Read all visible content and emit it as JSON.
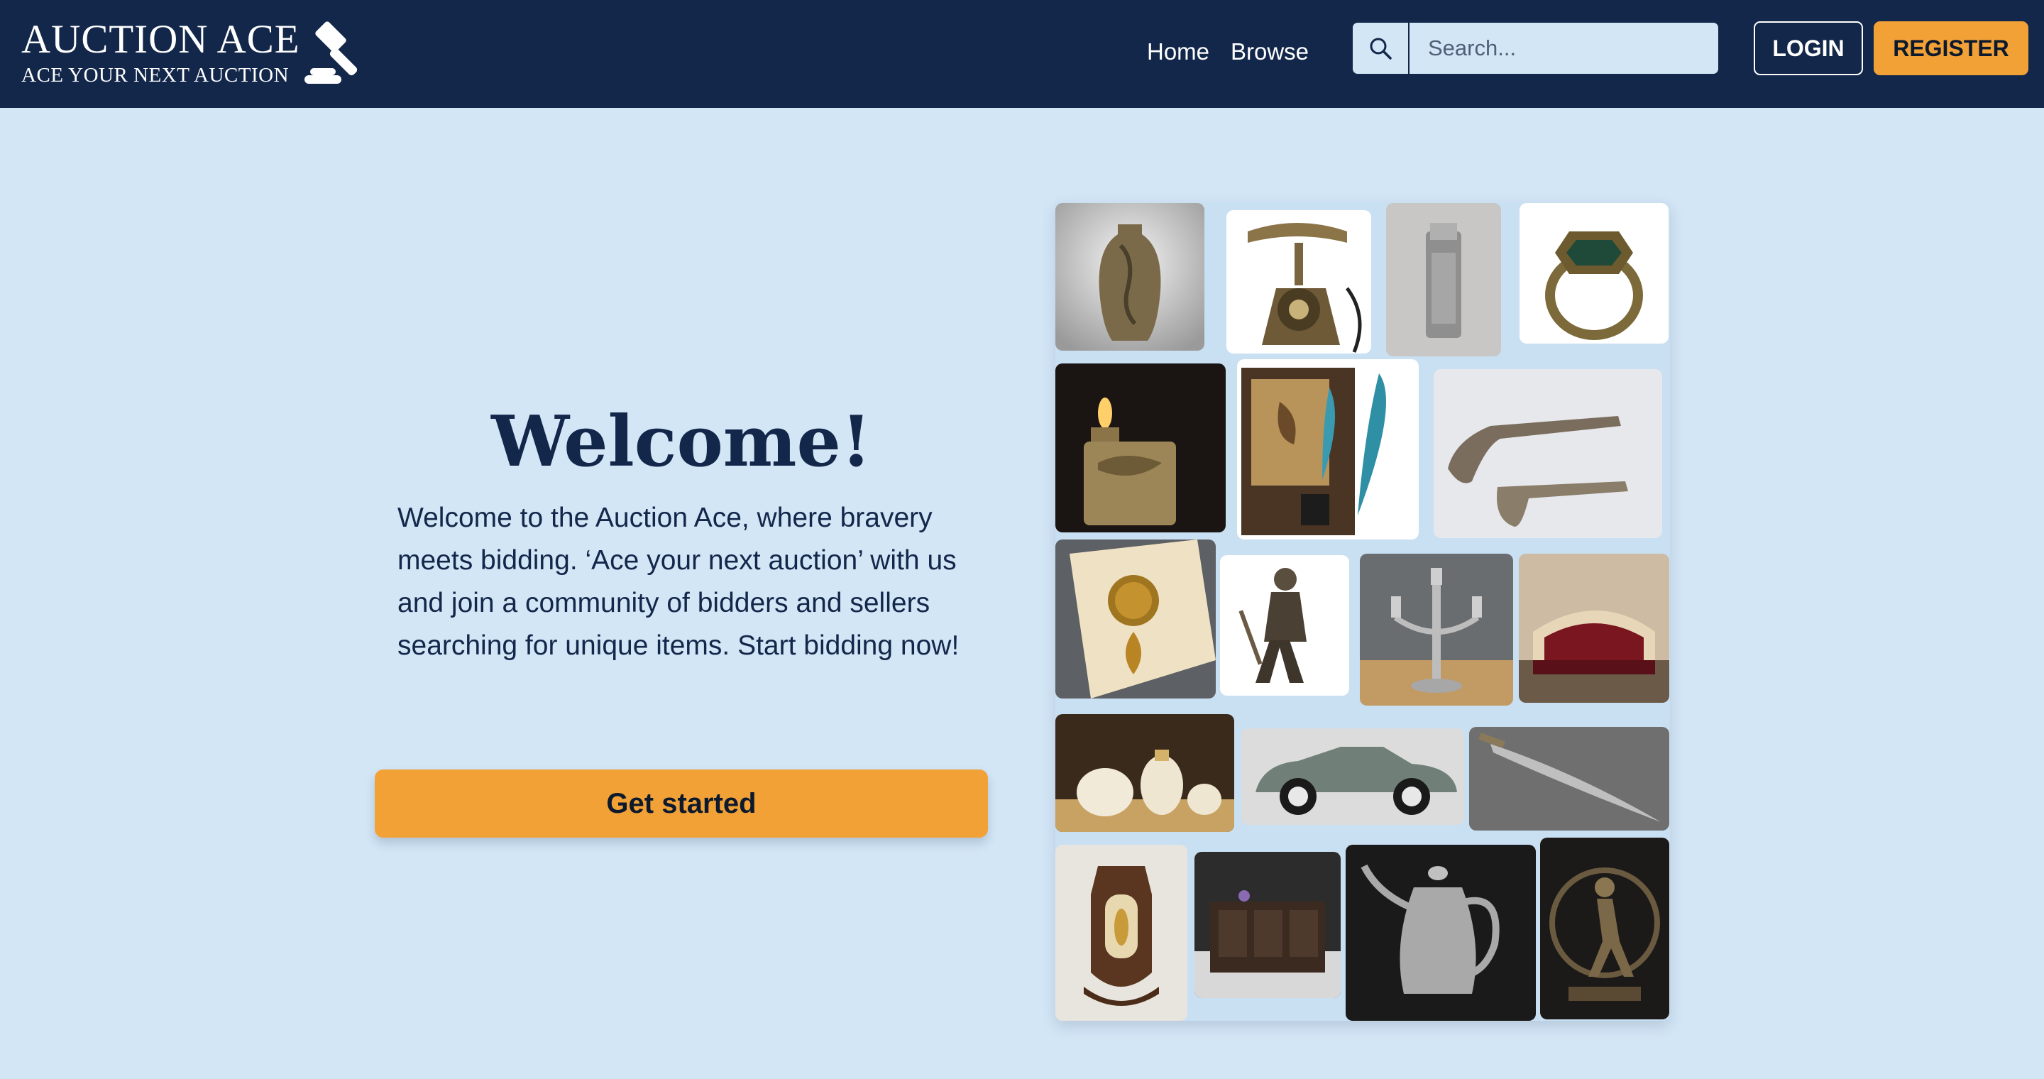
{
  "brand": {
    "name": "AUCTION ACE",
    "tagline": "ACE YOUR NEXT AUCTION"
  },
  "nav": {
    "links": [
      {
        "label": "Home"
      },
      {
        "label": "Browse"
      }
    ]
  },
  "search": {
    "placeholder": "Search...",
    "icon": "search-icon"
  },
  "auth": {
    "login_label": "LOGIN",
    "register_label": "REGISTER"
  },
  "hero": {
    "title": "Welcome!",
    "body": "Welcome to the Auction Ace, where bravery meets bidding. ‘Ace your next auction’ with us and join a community of bidders and sellers searching for unique items. Start bidding now!",
    "cta_label": "Get started"
  },
  "gallery": {
    "items": [
      {
        "name": "bronze-vase"
      },
      {
        "name": "antique-telephone"
      },
      {
        "name": "silver-lighter"
      },
      {
        "name": "emerald-ring"
      },
      {
        "name": "brass-lighter"
      },
      {
        "name": "quill-pen-set"
      },
      {
        "name": "flintlock-pistols"
      },
      {
        "name": "amber-pendant"
      },
      {
        "name": "warrior-statuette"
      },
      {
        "name": "silver-candelabra"
      },
      {
        "name": "victorian-sofa"
      },
      {
        "name": "porcelain-tea-set"
      },
      {
        "name": "vintage-car"
      },
      {
        "name": "curved-sword"
      },
      {
        "name": "ornate-wall-clock"
      },
      {
        "name": "carved-chest"
      },
      {
        "name": "silver-teapot"
      },
      {
        "name": "nataraja-statue"
      }
    ]
  },
  "colors": {
    "navbar": "#12274a",
    "page_background": "#d3e6f6",
    "accent": "#f2a137",
    "heading_text": "#12274a"
  }
}
